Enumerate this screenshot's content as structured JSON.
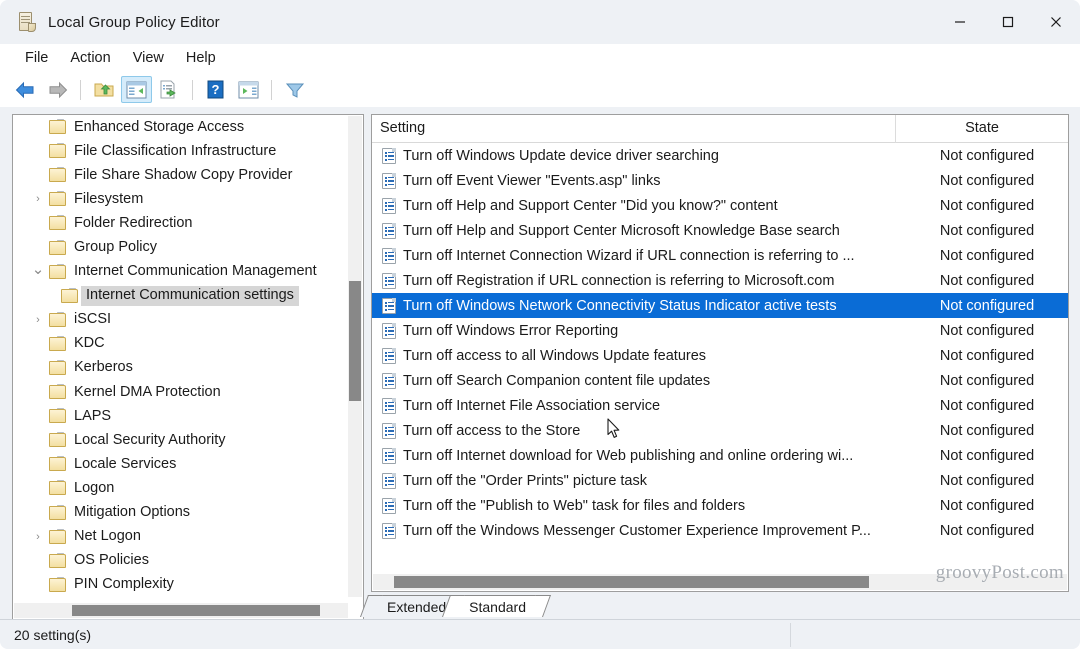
{
  "window": {
    "title": "Local Group Policy Editor",
    "icon": "console-scroll-icon",
    "controls": {
      "minimize": "minimize-button",
      "maximize": "maximize-button",
      "close": "close-button"
    }
  },
  "menubar": {
    "items": [
      {
        "label": "File"
      },
      {
        "label": "Action"
      },
      {
        "label": "View"
      },
      {
        "label": "Help"
      }
    ]
  },
  "toolbar": {
    "buttons": [
      {
        "name": "back-icon",
        "title": "Back"
      },
      {
        "name": "forward-icon",
        "title": "Forward"
      },
      {
        "name": "up-folder-icon",
        "title": "Up One Level"
      },
      {
        "name": "show-hide-console-tree-icon",
        "title": "Show/Hide Console Tree",
        "active": true
      },
      {
        "name": "export-list-icon",
        "title": "Export List"
      },
      {
        "name": "help-icon",
        "title": "Help"
      },
      {
        "name": "show-hide-action-pane-icon",
        "title": "Show/Hide Action Pane"
      },
      {
        "name": "filter-icon",
        "title": "Filter Options"
      }
    ]
  },
  "tree": {
    "items": [
      {
        "label": "Enhanced Storage Access",
        "expander": "none",
        "indent": false,
        "selected": false
      },
      {
        "label": "File Classification Infrastructure",
        "expander": "none",
        "indent": false,
        "selected": false
      },
      {
        "label": "File Share Shadow Copy Provider",
        "expander": "none",
        "indent": false,
        "selected": false
      },
      {
        "label": "Filesystem",
        "expander": "collapsed",
        "indent": false,
        "selected": false
      },
      {
        "label": "Folder Redirection",
        "expander": "none",
        "indent": false,
        "selected": false
      },
      {
        "label": "Group Policy",
        "expander": "none",
        "indent": false,
        "selected": false
      },
      {
        "label": "Internet Communication Management",
        "expander": "expanded",
        "indent": false,
        "selected": false
      },
      {
        "label": "Internet Communication settings",
        "expander": "none",
        "indent": true,
        "selected": true
      },
      {
        "label": "iSCSI",
        "expander": "collapsed",
        "indent": false,
        "selected": false
      },
      {
        "label": "KDC",
        "expander": "none",
        "indent": false,
        "selected": false
      },
      {
        "label": "Kerberos",
        "expander": "none",
        "indent": false,
        "selected": false
      },
      {
        "label": "Kernel DMA Protection",
        "expander": "none",
        "indent": false,
        "selected": false
      },
      {
        "label": "LAPS",
        "expander": "none",
        "indent": false,
        "selected": false
      },
      {
        "label": "Local Security Authority",
        "expander": "none",
        "indent": false,
        "selected": false
      },
      {
        "label": "Locale Services",
        "expander": "none",
        "indent": false,
        "selected": false
      },
      {
        "label": "Logon",
        "expander": "none",
        "indent": false,
        "selected": false
      },
      {
        "label": "Mitigation Options",
        "expander": "none",
        "indent": false,
        "selected": false
      },
      {
        "label": "Net Logon",
        "expander": "collapsed",
        "indent": false,
        "selected": false
      },
      {
        "label": "OS Policies",
        "expander": "none",
        "indent": false,
        "selected": false
      },
      {
        "label": "PIN Complexity",
        "expander": "none",
        "indent": false,
        "selected": false
      }
    ]
  },
  "list": {
    "columns": [
      {
        "label": "Setting"
      },
      {
        "label": "State"
      }
    ],
    "rows": [
      {
        "setting": "Turn off Windows Update device driver searching",
        "state": "Not configured",
        "selected": false
      },
      {
        "setting": "Turn off Event Viewer \"Events.asp\" links",
        "state": "Not configured",
        "selected": false
      },
      {
        "setting": "Turn off Help and Support Center \"Did you know?\" content",
        "state": "Not configured",
        "selected": false
      },
      {
        "setting": "Turn off Help and Support Center Microsoft Knowledge Base search",
        "state": "Not configured",
        "selected": false
      },
      {
        "setting": "Turn off Internet Connection Wizard if URL connection is referring to ...",
        "state": "Not configured",
        "selected": false
      },
      {
        "setting": "Turn off Registration if URL connection is referring to Microsoft.com",
        "state": "Not configured",
        "selected": false
      },
      {
        "setting": "Turn off Windows Network Connectivity Status Indicator active tests",
        "state": "Not configured",
        "selected": true
      },
      {
        "setting": "Turn off Windows Error Reporting",
        "state": "Not configured",
        "selected": false
      },
      {
        "setting": "Turn off access to all Windows Update features",
        "state": "Not configured",
        "selected": false
      },
      {
        "setting": "Turn off Search Companion content file updates",
        "state": "Not configured",
        "selected": false
      },
      {
        "setting": "Turn off Internet File Association service",
        "state": "Not configured",
        "selected": false
      },
      {
        "setting": "Turn off access to the Store",
        "state": "Not configured",
        "selected": false
      },
      {
        "setting": "Turn off Internet download for Web publishing and online ordering wi...",
        "state": "Not configured",
        "selected": false
      },
      {
        "setting": "Turn off the \"Order Prints\" picture task",
        "state": "Not configured",
        "selected": false
      },
      {
        "setting": "Turn off the \"Publish to Web\" task for files and folders",
        "state": "Not configured",
        "selected": false
      },
      {
        "setting": "Turn off the Windows Messenger Customer Experience Improvement P...",
        "state": "Not configured",
        "selected": false
      }
    ]
  },
  "tabs": [
    {
      "label": "Extended",
      "active": false
    },
    {
      "label": "Standard",
      "active": true
    }
  ],
  "statusbar": {
    "text": "20 setting(s)"
  },
  "watermark": {
    "text": "groovyPost.com"
  },
  "colors": {
    "selection_blue": "#0a6cd6",
    "window_chrome": "#eef1f5",
    "pane_background": "#ffffff",
    "tree_selection_gray": "#d6d6d6",
    "scrollbar_thumb": "#888888",
    "folder_yellow": "#f3dfa2"
  }
}
